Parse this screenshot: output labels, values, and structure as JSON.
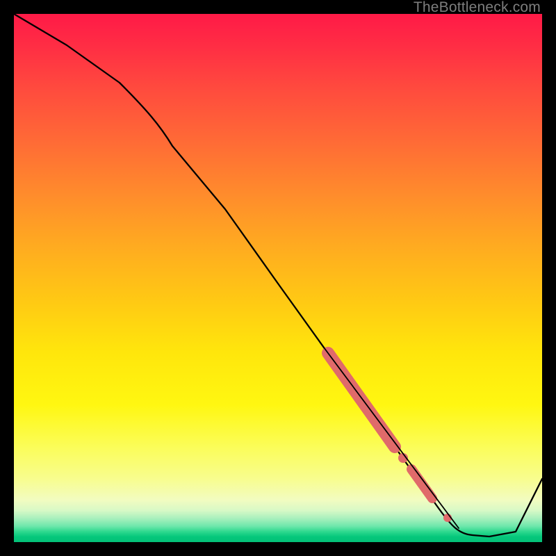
{
  "watermark": "TheBottleneck.com",
  "chart_data": {
    "type": "line",
    "title": "",
    "xlabel": "",
    "ylabel": "",
    "xlim": [
      0,
      100
    ],
    "ylim": [
      0,
      100
    ],
    "grid": false,
    "legend": false,
    "background": "rainbow-vertical-gradient",
    "series": [
      {
        "name": "bottleneck-curve",
        "color": "#000000",
        "x": [
          0,
          10,
          20,
          30,
          40,
          50,
          60,
          65,
          70,
          75,
          80,
          85,
          90,
          95,
          100
        ],
        "values": [
          100,
          94,
          87,
          77,
          63,
          49,
          35,
          28,
          21,
          14,
          7,
          2,
          1,
          2,
          12
        ]
      }
    ],
    "highlights": [
      {
        "name": "segment-a",
        "x_start": 60,
        "x_end": 72,
        "thickness": "thick",
        "color": "#e06a6a"
      },
      {
        "name": "dot-1",
        "x": 73.5,
        "thickness": "dot",
        "color": "#e06a6a"
      },
      {
        "name": "segment-b",
        "x_start": 75,
        "x_end": 79,
        "thickness": "medium",
        "color": "#e06a6a"
      },
      {
        "name": "dot-2",
        "x": 82,
        "thickness": "dot",
        "color": "#e06a6a"
      }
    ]
  }
}
